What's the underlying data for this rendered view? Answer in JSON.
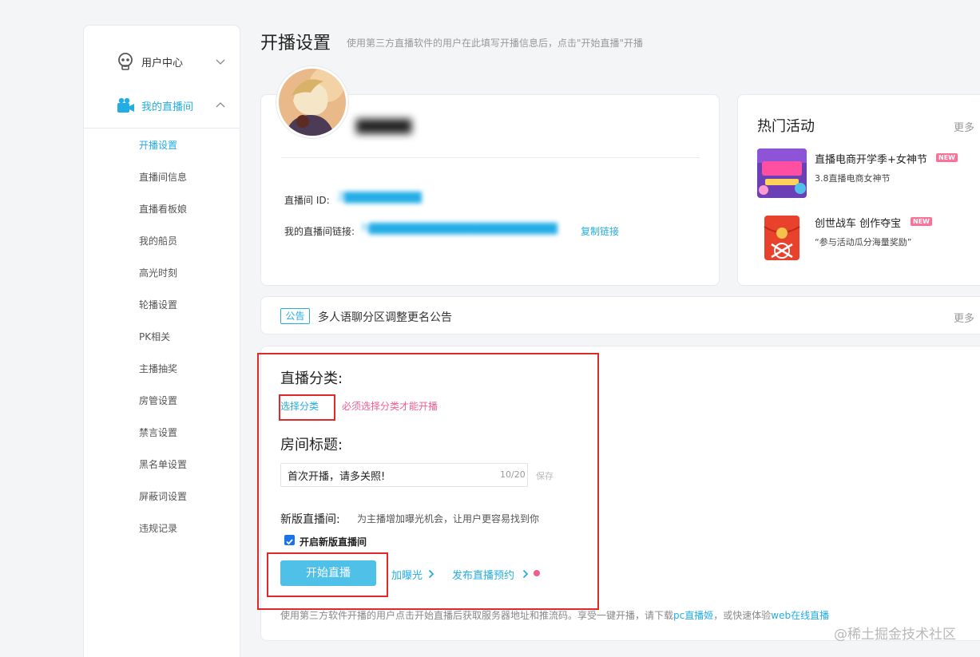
{
  "sidebar": {
    "groups": [
      {
        "label": "用户中心"
      },
      {
        "label": "我的直播间"
      }
    ],
    "items": [
      {
        "label": "开播设置"
      },
      {
        "label": "直播间信息"
      },
      {
        "label": "直播看板娘"
      },
      {
        "label": "我的船员"
      },
      {
        "label": "高光时刻"
      },
      {
        "label": "轮播设置"
      },
      {
        "label": "PK相关"
      },
      {
        "label": "主播抽奖"
      },
      {
        "label": "房管设置"
      },
      {
        "label": "禁言设置"
      },
      {
        "label": "黑名单设置"
      },
      {
        "label": "屏蔽词设置"
      },
      {
        "label": "违规记录"
      }
    ],
    "active_index": 0
  },
  "page": {
    "title": "开播设置",
    "subtitle": "使用第三方直播软件的用户在此填写开播信息后，点击\"开始直播\"开播"
  },
  "profile": {
    "username": "▇▇▇▇▇",
    "room_id_label": "直播间 ID:",
    "room_id_value": "2▇▇▇▇▇▇▇▇▇",
    "room_link_label": "我的直播间链接:",
    "room_link_value": "h▇▇▇▇▇▇▇▇▇▇▇▇▇▇▇▇▇▇▇▇▇▇▇",
    "copy_link": "复制链接"
  },
  "activities": {
    "title": "热门活动",
    "more": "更多",
    "items": [
      {
        "name": "直播电商开学季+女神节",
        "desc": "3.8直播电商女神节",
        "badge": "NEW"
      },
      {
        "name": "创世战车 创作夺宝",
        "desc": "“参与活动瓜分海量奖励”",
        "badge": "NEW"
      }
    ]
  },
  "notice": {
    "tag": "公告",
    "text": "多人语聊分区调整更名公告",
    "more": "更多"
  },
  "settings": {
    "category_title": "直播分类:",
    "select_category": "选择分类",
    "category_warning": "必须选择分类才能开播",
    "room_title_label": "房间标题:",
    "room_title_value": "首次开播，请多关照!",
    "room_title_count": "10/20",
    "save": "保存",
    "new_room_label": "新版直播间:",
    "new_room_desc": "为主播增加曝光机会，让用户更容易找到你",
    "new_room_checkbox": "开启新版直播间",
    "new_room_checked": true,
    "start_button": "开始直播",
    "boost_link": "加曝光",
    "schedule_link": "发布直播预约",
    "footer_note": "使用第三方软件开播的用户点击开始直播后获取服务器地址和推流码。享受一键开播，请下载",
    "footer_link1": "pc直播姬",
    "footer_mid": "，或快速体验",
    "footer_link2": "web在线直播"
  },
  "watermark": "@稀土掘金技术社区",
  "colors": {
    "accent": "#23ade5",
    "start_button": "#4fc1e9",
    "warning": "#f25d8e",
    "annotation": "#e02a2a"
  }
}
